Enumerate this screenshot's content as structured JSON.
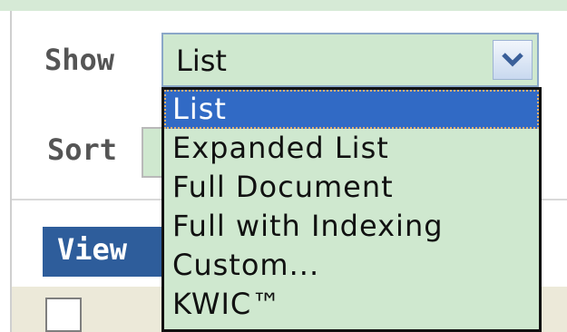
{
  "form": {
    "show_label": "Show",
    "sort_label": "Sort",
    "show_select": {
      "selected_value": "List",
      "options": [
        "List",
        "Expanded List",
        "Full Document",
        "Full with Indexing",
        "Custom...",
        "KWIC™"
      ],
      "highlighted_index": 0
    }
  },
  "results": {
    "view_button_label": "View"
  },
  "colors": {
    "band": "#d6ead6",
    "select_background": "#cfe8cf",
    "highlight": "#316ac5",
    "view_button": "#2e5d9b",
    "row_background": "#ece9d9"
  },
  "icons": {
    "dropdown_arrow": "chevron-down-icon"
  }
}
